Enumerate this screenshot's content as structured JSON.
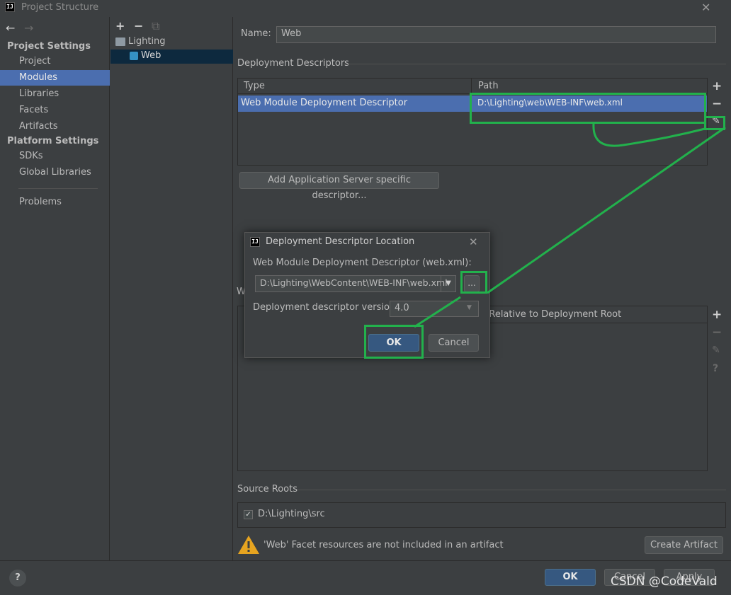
{
  "window": {
    "title": "Project Structure",
    "logo": "IJ",
    "close": "✕"
  },
  "nav": {
    "back": "←",
    "forward": "→"
  },
  "sidebar": {
    "project_settings_header": "Project Settings",
    "items_ps": [
      {
        "label": "Project"
      },
      {
        "label": "Modules"
      },
      {
        "label": "Libraries"
      },
      {
        "label": "Facets"
      },
      {
        "label": "Artifacts"
      }
    ],
    "platform_settings_header": "Platform Settings",
    "items_pl": [
      {
        "label": "SDKs"
      },
      {
        "label": "Global Libraries"
      }
    ],
    "problems": "Problems"
  },
  "tree": {
    "toolbar": {
      "add": "+",
      "remove": "−",
      "copy": "⧉"
    },
    "nodes": [
      {
        "label": "Lighting"
      },
      {
        "label": "Web"
      }
    ]
  },
  "main": {
    "name_label": "Name:",
    "name_value": "Web",
    "descriptors_title": "Deployment Descriptors",
    "table": {
      "col_type": "Type",
      "col_path": "Path",
      "row_type": "Web Module Deployment Descriptor",
      "row_path": "D:\\Lighting\\web\\WEB-INF\\web.xml"
    },
    "table_tools": {
      "add": "+",
      "remove": "−",
      "edit": "✎"
    },
    "add_server_btn": "Add Application Server specific descriptor...",
    "web_resource_label": "W",
    "lower_table_header": "h Relative to Deployment Root",
    "lower_tools": {
      "add": "+",
      "remove": "−",
      "edit": "✎",
      "help": "?"
    },
    "source_roots_title": "Source Roots",
    "source_root": "D:\\Lighting\\src",
    "warning": "'Web' Facet resources are not included in an artifact",
    "create_artifact_btn": "Create Artifact"
  },
  "dialog": {
    "title": "Deployment Descriptor Location",
    "close": "✕",
    "field_label": "Web Module Deployment Descriptor (web.xml):",
    "path_value": "D:\\Lighting\\WebContent\\WEB-INF\\web.xml",
    "browse": "...",
    "version_label": "Deployment descriptor version",
    "version_value": "4.0",
    "ok": "OK",
    "cancel": "Cancel"
  },
  "footer": {
    "help": "?",
    "ok": "OK",
    "cancel": "Cancel",
    "apply": "Apply",
    "watermark": "CSDN @CodeVald"
  },
  "colors": {
    "accent": "#4b6eaf",
    "annotation": "#22b14c",
    "background": "#3c3f41"
  }
}
